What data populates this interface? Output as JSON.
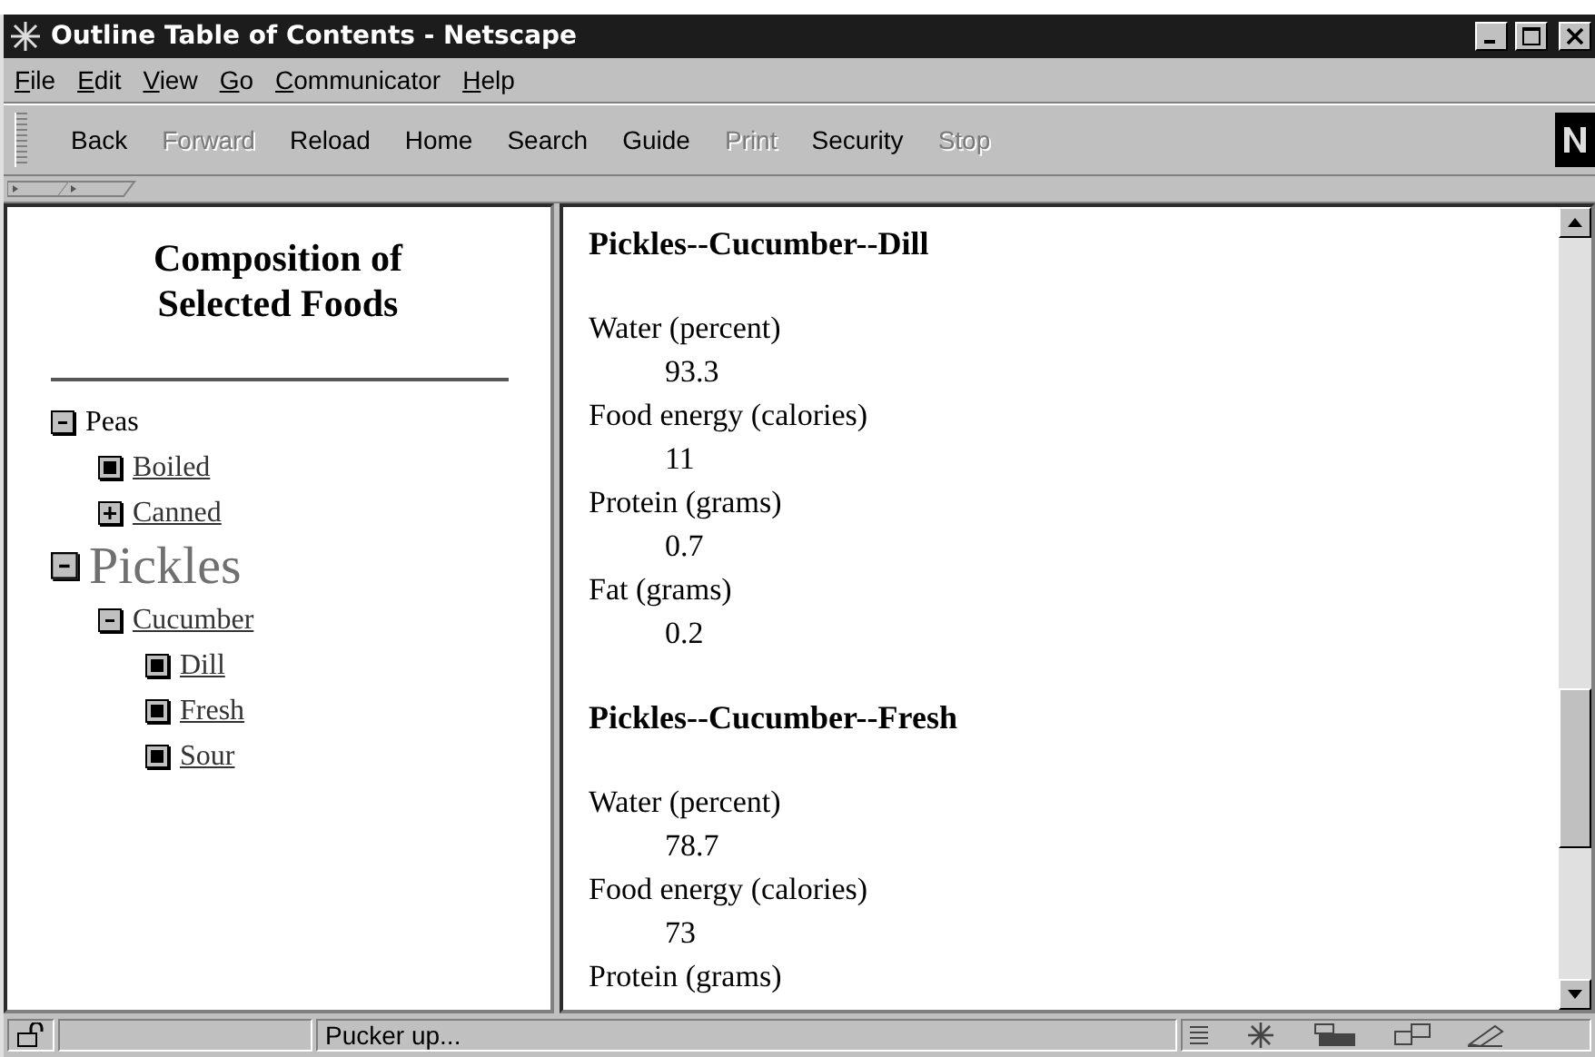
{
  "window": {
    "title": "Outline Table of Contents - Netscape"
  },
  "menu": [
    {
      "label": "File"
    },
    {
      "label": "Edit"
    },
    {
      "label": "View"
    },
    {
      "label": "Go"
    },
    {
      "label": "Communicator"
    },
    {
      "label": "Help"
    }
  ],
  "toolbar": [
    {
      "label": "Back",
      "disabled": false
    },
    {
      "label": "Forward",
      "disabled": true
    },
    {
      "label": "Reload",
      "disabled": false
    },
    {
      "label": "Home",
      "disabled": false
    },
    {
      "label": "Search",
      "disabled": false
    },
    {
      "label": "Guide",
      "disabled": false
    },
    {
      "label": "Print",
      "disabled": true
    },
    {
      "label": "Security",
      "disabled": false
    },
    {
      "label": "Stop",
      "disabled": true
    }
  ],
  "left_frame": {
    "title": "Composition of Selected Foods",
    "tree": [
      {
        "label": "Peas",
        "kind": "collapse",
        "link": false,
        "current": false,
        "children": [
          {
            "label": "Boiled",
            "kind": "leaf",
            "link": true,
            "current": false
          },
          {
            "label": "Canned",
            "kind": "expand",
            "link": true,
            "current": false
          }
        ]
      },
      {
        "label": "Pickles",
        "kind": "collapse",
        "link": false,
        "current": true,
        "children": [
          {
            "label": "Cucumber",
            "kind": "collapse",
            "link": true,
            "current": false,
            "children": [
              {
                "label": "Dill",
                "kind": "leaf",
                "link": true,
                "current": false
              },
              {
                "label": "Fresh",
                "kind": "leaf",
                "link": true,
                "current": false
              },
              {
                "label": "Sour",
                "kind": "leaf",
                "link": true,
                "current": false
              }
            ]
          }
        ]
      }
    ]
  },
  "right_frame": {
    "sections": [
      {
        "heading": "Pickles--Cucumber--Dill",
        "fields": [
          {
            "label": "Water (percent)",
            "value": "93.3"
          },
          {
            "label": "Food energy (calories)",
            "value": "11"
          },
          {
            "label": "Protein (grams)",
            "value": "0.7"
          },
          {
            "label": "Fat (grams)",
            "value": "0.2"
          }
        ]
      },
      {
        "heading": "Pickles--Cucumber--Fresh",
        "fields": [
          {
            "label": "Water (percent)",
            "value": "78.7"
          },
          {
            "label": "Food energy (calories)",
            "value": "73"
          },
          {
            "label": "Protein (grams)"
          }
        ]
      }
    ]
  },
  "status_bar": {
    "text": "Pucker up..."
  }
}
